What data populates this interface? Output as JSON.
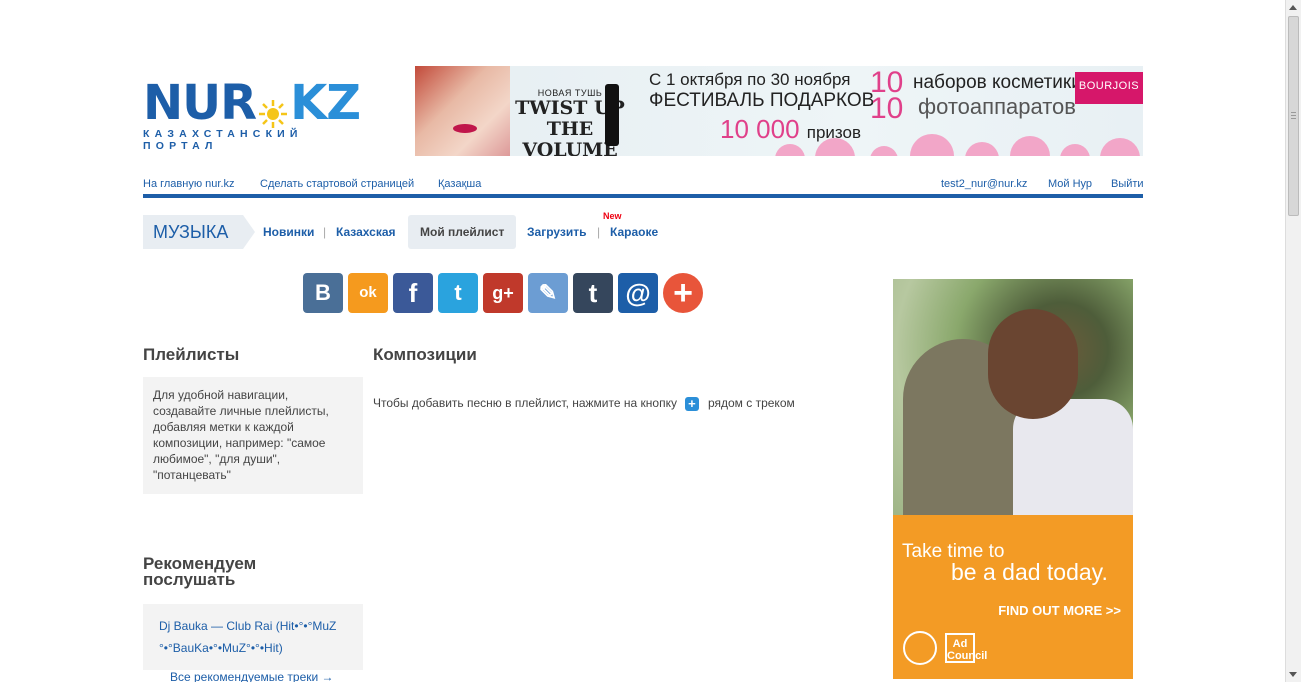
{
  "logo": {
    "text_left": "NUR",
    "text_right": "KZ",
    "tagline": "КАЗАХСТАНСКИЙ ПОРТАЛ"
  },
  "banner": {
    "small": "НОВАЯ ТУШЬ",
    "product": "TWIST UP THE VOLUME",
    "line1": "С 1 октября по 30 ноября",
    "line2": "ФЕСТИВАЛЬ ПОДАРКОВ",
    "prize_count": "10 000",
    "prize_unit": "призов",
    "n1": "10",
    "g1": "наборов косметики",
    "n2": "10",
    "g2": "фотоаппаратов",
    "brand": "BOURJOIS"
  },
  "topnav": {
    "home": "На главную nur.kz",
    "start": "Сделать стартовой страницей",
    "lang": "Қазақша",
    "email": "test2_nur@nur.kz",
    "my": "Мой Нур",
    "logout": "Выйти"
  },
  "secnav": {
    "title": "МУЗЫКА",
    "tabs": [
      "Новинки",
      "Казахская",
      "Мой плейлист",
      "Загрузить",
      "Караоке"
    ],
    "new_badge": "New"
  },
  "share": {
    "buttons": [
      {
        "name": "vk",
        "glyph": "В",
        "color": "#4a6f97"
      },
      {
        "name": "odnoklassniki",
        "glyph": "ok",
        "color": "#f59a1e"
      },
      {
        "name": "facebook",
        "glyph": "f",
        "color": "#3b5998"
      },
      {
        "name": "twitter",
        "glyph": "t",
        "color": "#2aa3de"
      },
      {
        "name": "google-plus",
        "glyph": "g+",
        "color": "#c0392b"
      },
      {
        "name": "livejournal",
        "glyph": "✎",
        "color": "#6c9dd3"
      },
      {
        "name": "tumblr",
        "glyph": "t",
        "color": "#35465c"
      },
      {
        "name": "mail-ru",
        "glyph": "@",
        "color": "#1d5ea8"
      },
      {
        "name": "more",
        "glyph": "+",
        "color": "#e8553a"
      }
    ]
  },
  "playlists": {
    "title": "Плейлисты",
    "info": "Для удобной навигации, создавайте личные плейлисты, добавляя метки к каждой композиции, например: \"самое любимое\", \"для души\", \"потанцевать\""
  },
  "compositions": {
    "title": "Композиции",
    "hint_before": "Чтобы добавить песню в плейлист, нажмите на кнопку",
    "hint_after": "рядом с треком"
  },
  "recommend": {
    "title": "Рекомендуем послушать",
    "track": "Dj Bauka — Club Rai (Hit•°•°MuZ °•°BauKa•°•MuZ°•°•Hit)",
    "all_link": "Все рекомендуемые треки →"
  },
  "ad": {
    "t1": "Take time to",
    "t2": "be a dad today.",
    "cta": "FIND OUT MORE >>",
    "adcouncil": "Ad Council"
  }
}
